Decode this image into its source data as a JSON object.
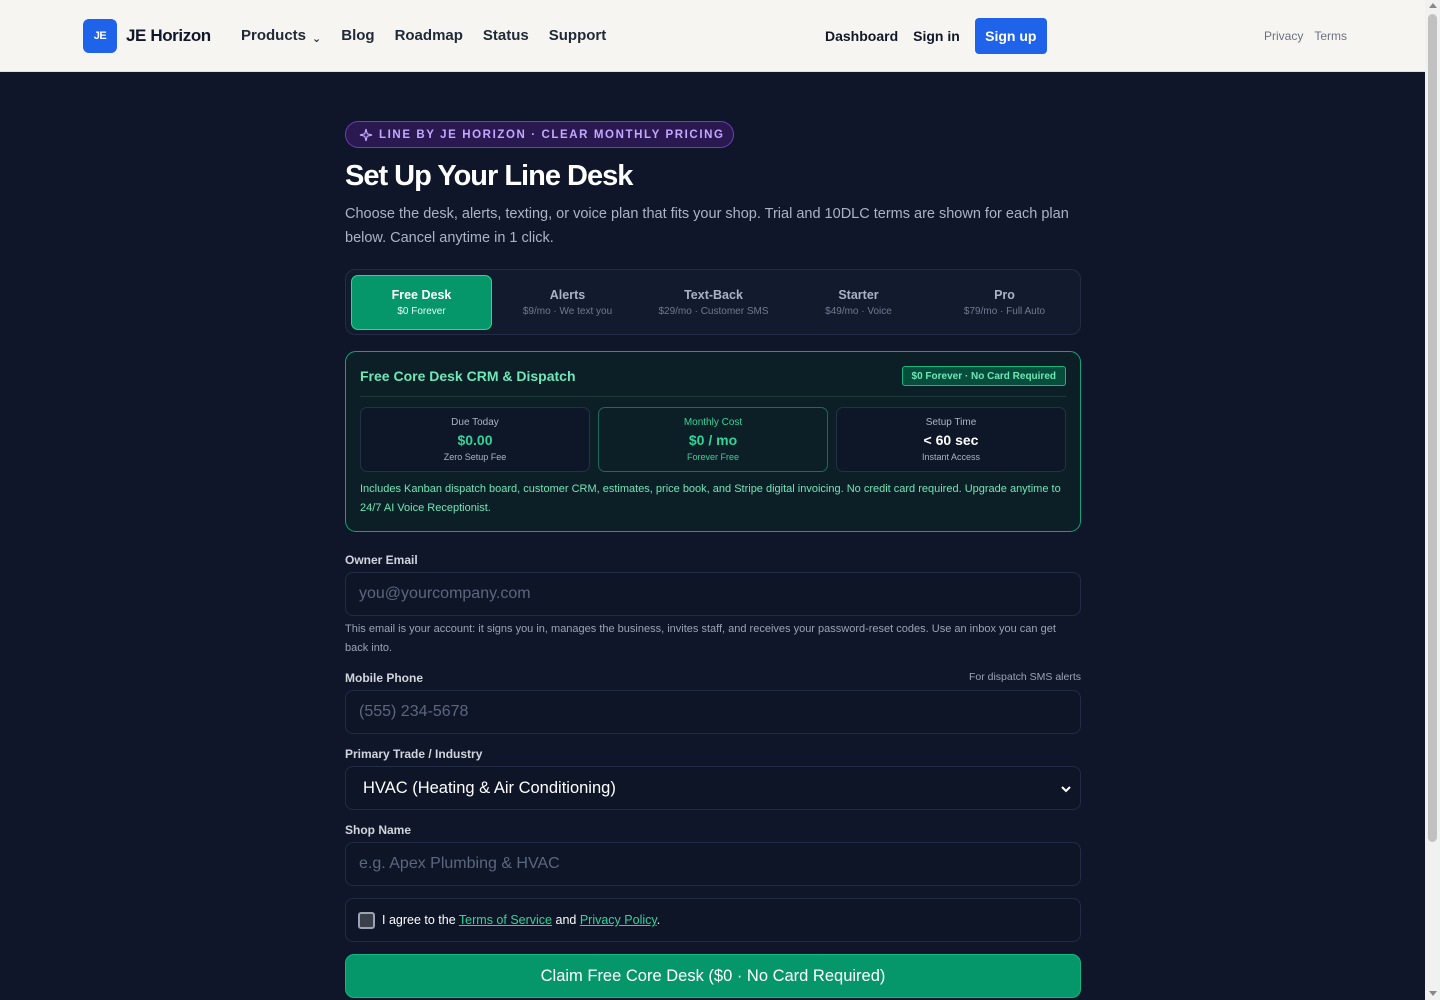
{
  "header": {
    "logo_text": "JE",
    "brand": "JE Horizon",
    "nav": [
      "Products",
      "Blog",
      "Roadmap",
      "Status",
      "Support"
    ],
    "dashboard": "Dashboard",
    "sign_in": "Sign in",
    "sign_up": "Sign up",
    "privacy": "Privacy",
    "terms": "Terms",
    "accent": "#1e63ea"
  },
  "hero": {
    "badge": "LINE BY JE HORIZON · CLEAR MONTHLY PRICING",
    "title": "Set Up Your Line Desk",
    "subtitle": "Choose the desk, alerts, texting, or voice plan that fits your shop. Trial and 10DLC terms are shown for each plan below. Cancel anytime in 1 click."
  },
  "tabs": [
    {
      "name": "Free Desk",
      "sub": "$0 Forever",
      "active": true
    },
    {
      "name": "Alerts",
      "sub": "$9/mo · We text you",
      "active": false
    },
    {
      "name": "Text-Back",
      "sub": "$29/mo · Customer SMS",
      "active": false
    },
    {
      "name": "Starter",
      "sub": "$49/mo · Voice",
      "active": false
    },
    {
      "name": "Pro",
      "sub": "$79/mo · Full Auto",
      "active": false
    }
  ],
  "plan": {
    "title": "Free Core Desk CRM & Dispatch",
    "badge": "$0 Forever · No Card Required",
    "stats": [
      {
        "label": "Due Today",
        "value": "$0.00",
        "sub": "Zero Setup Fee"
      },
      {
        "label": "Monthly Cost",
        "value": "$0 / mo",
        "sub": "Forever Free"
      },
      {
        "label": "Setup Time",
        "value": "< 60 sec",
        "sub": "Instant Access"
      }
    ],
    "description": "Includes Kanban dispatch board, customer CRM, estimates, price book, and Stripe digital invoicing. No credit card required. Upgrade anytime to 24/7 AI Voice Receptionist.",
    "accent": "#10b981"
  },
  "form": {
    "email_label": "Owner Email",
    "email_placeholder": "you@yourcompany.com",
    "email_help": "This email is your account: it signs you in, manages the business, invites staff, and receives your password-reset codes. Use an inbox you can get back into.",
    "phone_label": "Mobile Phone",
    "phone_hint": "For dispatch SMS alerts",
    "phone_placeholder": "(555) 234-5678",
    "trade_label": "Primary Trade / Industry",
    "trade_value": "HVAC (Heating & Air Conditioning)",
    "shop_label": "Shop Name",
    "shop_placeholder": "e.g. Apex Plumbing & HVAC",
    "agree_prefix": "I agree to the ",
    "agree_tos": "Terms of Service",
    "agree_and": " and ",
    "agree_privacy": "Privacy Policy",
    "agree_suffix": ".",
    "submit": "Claim Free Core Desk ($0 · No Card Required)"
  }
}
